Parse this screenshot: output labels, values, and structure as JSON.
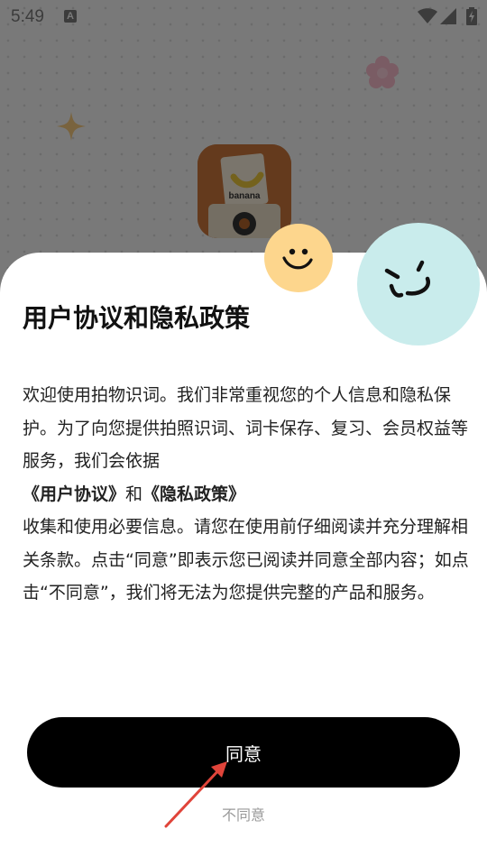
{
  "status_bar": {
    "time": "5:49",
    "notification_badge": "A",
    "icons": [
      "wifi-icon",
      "signal-icon",
      "battery-charging-icon"
    ]
  },
  "background_app": {
    "logo_text": "banana",
    "decorations": [
      "star-icon",
      "flower-icon"
    ]
  },
  "dialog": {
    "title": "用户协议和隐私政策",
    "paragraph_1": "欢迎使用拍物识词。我们非常重视您的个人信息和隐私保护。为了向您提供拍照识词、词卡保存、复习、会员权益等服务，我们会依据",
    "user_agreement_link": "《用户协议》",
    "and_text": "和",
    "privacy_policy_link": "《隐私政策》",
    "paragraph_2": "收集和使用必要信息。请您在使用前仔细阅读并充分理解相关条款。点击“同意”即表示您已阅读并同意全部内容；如点击“不同意”，我们将无法为您提供完整的产品和服务。",
    "agree_label": "同意",
    "disagree_label": "不同意",
    "decorations": [
      "smile-face-icon",
      "wink-face-icon"
    ]
  },
  "colors": {
    "button_bg": "#000000",
    "sheet_bg": "#ffffff",
    "face_yellow": "#fdd68d",
    "face_cyan": "#c9ecec",
    "annotation_arrow": "#e0443a"
  }
}
